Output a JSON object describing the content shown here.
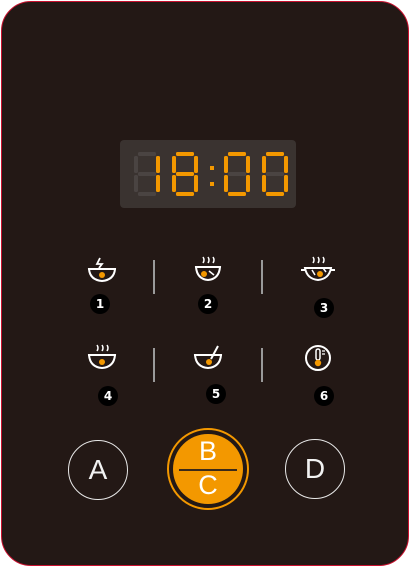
{
  "display": {
    "digits": [
      "1",
      "8",
      "0",
      "0"
    ],
    "colon": ":",
    "active_color": "#f39800",
    "inactive_color": "#4a4442"
  },
  "functions": [
    {
      "icon": "rice-bowl-lightning-icon",
      "number": "1"
    },
    {
      "icon": "steaming-pot-soup-icon",
      "number": "2"
    },
    {
      "icon": "steaming-wok-stirfry-icon",
      "number": "3"
    },
    {
      "icon": "steaming-bowl-icon",
      "number": "4"
    },
    {
      "icon": "bowl-ladle-icon",
      "number": "5"
    },
    {
      "icon": "thermometer-icon",
      "number": "6"
    }
  ],
  "buttons": {
    "a_label": "A",
    "b_label": "B",
    "c_label": "C",
    "d_label": "D"
  },
  "colors": {
    "panel": "#231815",
    "border": "#c8102e",
    "accent": "#f39800",
    "outline": "#e8e8e8"
  }
}
